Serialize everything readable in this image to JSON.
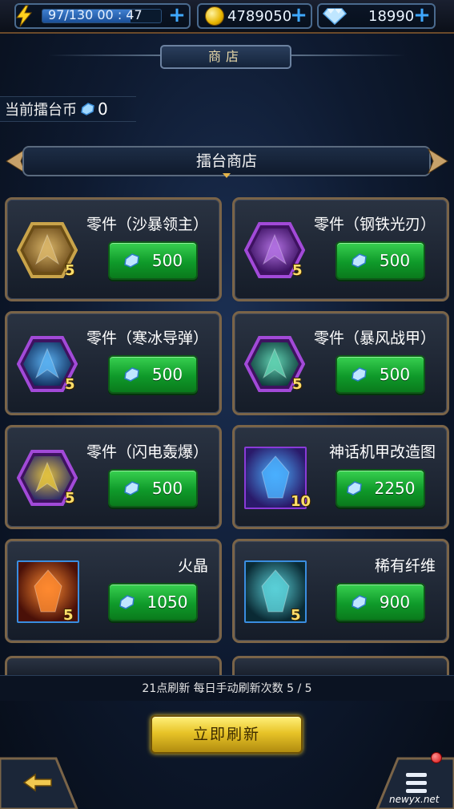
{
  "topbar": {
    "energy": {
      "text": "97/130   00 : 47",
      "current": 97,
      "max": 130,
      "timer": "00 : 47"
    },
    "gold": {
      "value": "4789050"
    },
    "gems": {
      "value": "18990"
    }
  },
  "shop": {
    "title": "商店"
  },
  "currency": {
    "label": "当前擂台币",
    "count": "0"
  },
  "section": {
    "title": "擂台商店"
  },
  "items": [
    {
      "name": "零件（沙暴领主）",
      "qty": "5",
      "price": "500",
      "icon": "sandstorm-lord-part-icon",
      "frame": "hexagon-gold"
    },
    {
      "name": "零件（钢铁光刃）",
      "qty": "5",
      "price": "500",
      "icon": "steel-blade-part-icon",
      "frame": "hexagon-purple"
    },
    {
      "name": "零件（寒冰导弹）",
      "qty": "5",
      "price": "500",
      "icon": "ice-missile-part-icon",
      "frame": "hexagon-purple"
    },
    {
      "name": "零件（暴风战甲）",
      "qty": "5",
      "price": "500",
      "icon": "storm-armor-part-icon",
      "frame": "hexagon-purple"
    },
    {
      "name": "零件（闪电轰爆）",
      "qty": "5",
      "price": "500",
      "icon": "lightning-blast-part-icon",
      "frame": "hexagon-purple"
    },
    {
      "name": "神话机甲改造图",
      "qty": "10",
      "price": "2250",
      "icon": "mythic-mech-blueprint-icon",
      "frame": "square-purple"
    },
    {
      "name": "火晶",
      "qty": "5",
      "price": "1050",
      "icon": "fire-crystal-icon",
      "frame": "square-blue"
    },
    {
      "name": "稀有纤维",
      "qty": "5",
      "price": "900",
      "icon": "rare-fiber-icon",
      "frame": "square-blue"
    }
  ],
  "footer": {
    "refresh_info": "21点刷新  每日手动刷新次数 5 / 5",
    "refresh_button": "立即刷新",
    "watermark": "newyx.net"
  },
  "colors": {
    "buy_button": "#1aa832",
    "refresh_button": "#e8c428",
    "card_border": "#7a6448",
    "qty_text": "#ffdf6a"
  }
}
